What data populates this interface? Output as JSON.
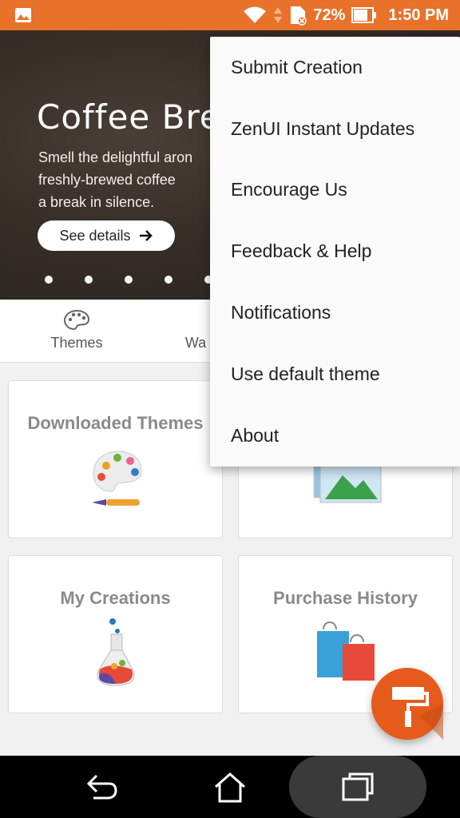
{
  "status_bar": {
    "battery_percent": "72%",
    "time": "1:50 PM",
    "icons": [
      "gallery-icon",
      "wifi-icon",
      "data-arrows-icon",
      "sim-icon",
      "battery-icon"
    ]
  },
  "banner": {
    "title": "Coffee Bre",
    "description": "Smell the delightful aron\nfreshly-brewed coffee\na break in silence.",
    "button_label": "See details",
    "dot_count": 5
  },
  "tabs": [
    {
      "label": "Themes",
      "icon": "palette-icon"
    },
    {
      "label": "Wa",
      "icon": "wallpaper-icon"
    }
  ],
  "cards": [
    {
      "label": "Downloaded Themes",
      "icon": "palette-brush-icon"
    },
    {
      "label": "",
      "icon": "landscape-image-icon"
    },
    {
      "label": "My Creations",
      "icon": "flask-icon"
    },
    {
      "label": "Purchase History",
      "icon": "shopping-bags-icon"
    }
  ],
  "menu": {
    "items": [
      "Submit Creation",
      "ZenUI Instant Updates",
      "Encourage Us",
      "Feedback & Help",
      "Notifications",
      "Use default theme",
      "About"
    ]
  },
  "fab": {
    "icon": "paint-roller-icon"
  },
  "nav": {
    "icons": [
      "back-icon",
      "home-icon",
      "recents-icon"
    ]
  },
  "colors": {
    "accent": "#e8722a",
    "fab": "#e65a1b",
    "card_text": "#8a8a8a"
  }
}
